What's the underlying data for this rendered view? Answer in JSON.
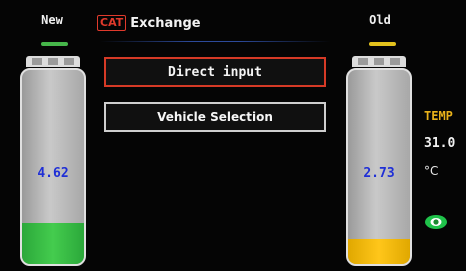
{
  "header": {
    "new_label": "New",
    "old_label": "Old",
    "badge": "CAT",
    "title": "Exchange"
  },
  "buttons": {
    "direct_input": "Direct input",
    "vehicle_selection": "Vehicle Selection"
  },
  "batteries": {
    "new": {
      "value": "4.62",
      "fill_level": 0.21,
      "color": "#44cc4e"
    },
    "old": {
      "value": "2.73",
      "fill_level": 0.13,
      "color": "#ffc61a"
    }
  },
  "temperature": {
    "label": "TEMP",
    "value": "31.0",
    "unit": "°C"
  },
  "icons": {
    "status": "eye-icon"
  },
  "colors": {
    "accent_red": "#d63a26",
    "new_green": "#46b64a",
    "old_yellow": "#e3c21d",
    "value_blue": "#1f2fd6",
    "temp_label": "#e9b21a"
  }
}
